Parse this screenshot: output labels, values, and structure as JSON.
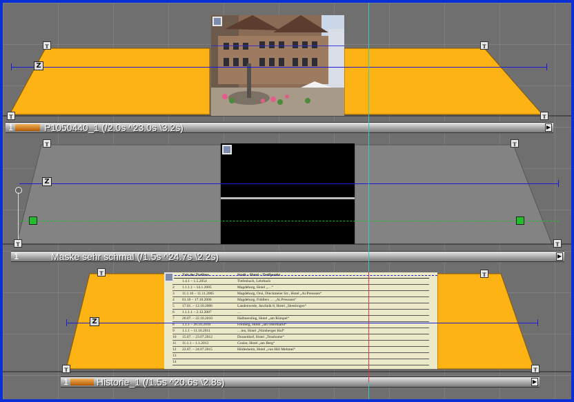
{
  "tracks": [
    {
      "number": "1",
      "clip_label": "P1050440_1 (/2.0s ^23.0s \\3.2s)",
      "image_alt": "photo-building"
    },
    {
      "number": "1",
      "clip_label": "Maske sehr schmal (/1.5s ^24.7s \\2.2s)",
      "image_alt": "mask-black"
    },
    {
      "number": "1",
      "clip_label": "Historie_1 (/1.5s ^20.6s \\2.8s)",
      "image_alt": "document-table",
      "document": {
        "header": [
          "Zeit des Treffens",
          "Stadt – Hotel – Treffpunkt"
        ],
        "rows": [
          [
            "1",
            "1.4.1 – 1.5.2054",
            "Tiefenbach, Lehrbach"
          ],
          [
            "2",
            "1.1.1.1 – 14.1.2005",
            "Magdeburg, Hotel „…“"
          ],
          [
            "3",
            "11.1.10 – 11.11.2005",
            "Magdeburg, Orsi, Dieckmeier Str., Hotel „Ai.Preussen“"
          ],
          [
            "4",
            "01.10 – 17.10.2006",
            "Magdeburg, Fiddlers … „Ai.Preussen“"
          ],
          [
            "5",
            "17.01. – 12.10.2006",
            "Landenwede, Jaschnik 8, Hotel „Sleesbogen“"
          ],
          [
            "6",
            "1.1.1.1 – 2.12.2007",
            "…"
          ],
          [
            "7",
            "20.07. – 22.10.2010",
            "Halbnersling, Hotel „am Rümpel“"
          ],
          [
            "8",
            "1.1.1 – 20.10.2010",
            "Freiberg, Hotel „am Obermarkt“"
          ],
          [
            "9",
            "1.1.1 – 11.10.2011",
            "…ien, Hotel „Nürnberger Hof“"
          ],
          [
            "10",
            "15.07. – 23.07.2012",
            "Dusseldorf, Hotel „Tenshome“"
          ],
          [
            "11",
            "11.1.1 – 1.1.2013",
            "Goslar, Hotel „am Berg“"
          ],
          [
            "12",
            "22.07. – 24.07.2015",
            "Hildesheim, Hotel „van Hill Mehmel“"
          ],
          [
            "13",
            "",
            ""
          ],
          [
            "14",
            "",
            ""
          ]
        ]
      }
    }
  ],
  "colors": {
    "frame": "#0a2fd6",
    "background": "#6f6f6f",
    "clip_fill": "#fdb314",
    "keyframe_line": "#1a1ad6",
    "mask_line": "#1fbf2a",
    "playhead_cyan": "#35c7c0",
    "playhead_red": "#e0374a"
  },
  "icons": {
    "keyframe_handle": "pin-handle-icon",
    "zoom_marker": "z-marker-icon",
    "end_marker": "track-end-icon"
  }
}
